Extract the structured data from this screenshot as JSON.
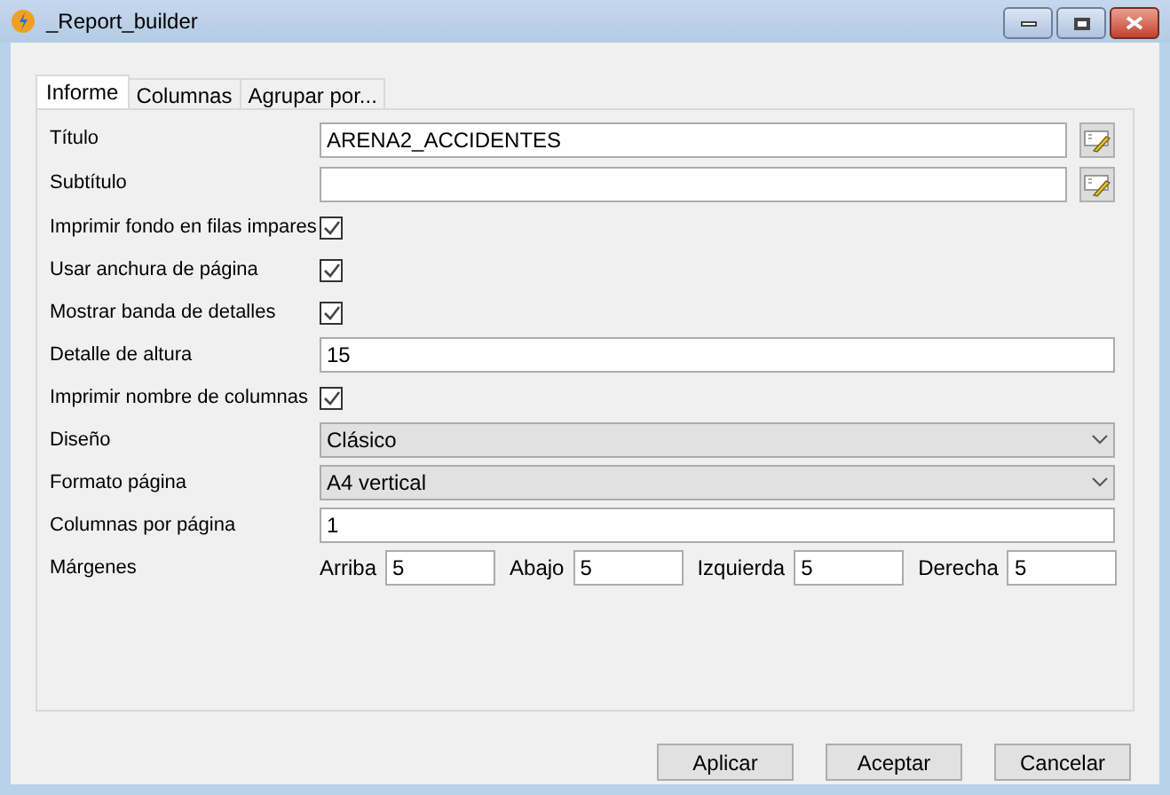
{
  "window": {
    "title": "_Report_builder"
  },
  "tabs": [
    {
      "label": "Informe",
      "selected": true
    },
    {
      "label": "Columnas",
      "selected": false
    },
    {
      "label": "Agrupar por...",
      "selected": false
    }
  ],
  "form": [
    {
      "kind": "text_edit",
      "label": "Título",
      "value": "ARENA2_ACCIDENTES"
    },
    {
      "kind": "text_edit",
      "label": "Subtítulo"
    },
    {
      "kind": "checkbox",
      "label": "Imprimir fondo en filas impares",
      "checked": true
    },
    {
      "kind": "checkbox",
      "label": "Usar anchura de página",
      "checked": true
    },
    {
      "kind": "checkbox",
      "label": "Mostrar banda de detalles",
      "checked": true
    },
    {
      "kind": "text",
      "label": "Detalle de altura",
      "value": "15"
    },
    {
      "kind": "checkbox",
      "label": "Imprimir nombre de columnas",
      "checked": true
    },
    {
      "kind": "select",
      "label": "Diseño",
      "value": "Clásico"
    },
    {
      "kind": "select",
      "label": "Formato página",
      "value": "A4 vertical"
    },
    {
      "kind": "text",
      "label": "Columnas por página",
      "value": "1"
    },
    {
      "kind": "margins",
      "label": "Márgenes",
      "fields": [
        {
          "label": "Arriba",
          "value": "5"
        },
        {
          "label": "Abajo",
          "value": "5"
        },
        {
          "label": "Izquierda",
          "value": "5"
        },
        {
          "label": "Derecha",
          "value": "5"
        }
      ]
    }
  ],
  "buttons": [
    "Aplicar",
    "Aceptar",
    "Cancelar"
  ]
}
